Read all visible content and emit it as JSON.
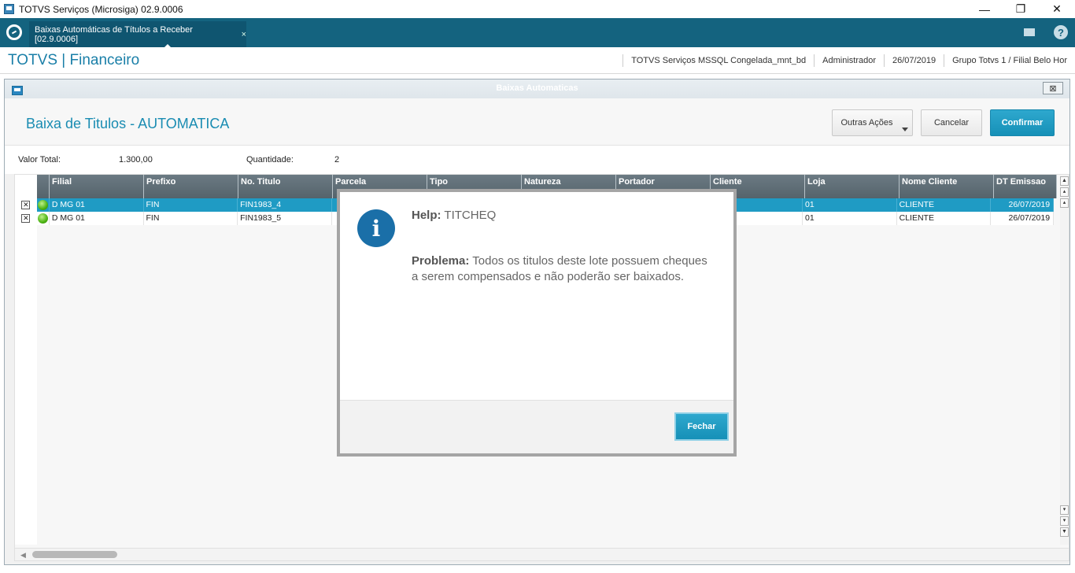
{
  "window": {
    "title": "TOTVS Serviços (Microsiga) 02.9.0006",
    "controls": [
      "—",
      "❐",
      "✕"
    ]
  },
  "tabbar": {
    "tab_label": "Baixas Automáticas de Títulos a Receber [02.9.0006]",
    "tab_close": "×",
    "help_glyph": "?"
  },
  "header": {
    "app_title": "TOTVS | Financeiro",
    "info": [
      "TOTVS Serviços MSSQL Congelada_mnt_bd",
      "Administrador",
      "26/07/2019",
      "Grupo Totvs 1 / Filial Belo Hor"
    ]
  },
  "dialog": {
    "title": "Baixas Automaticas",
    "close_glyph": "⊠",
    "form_title": "Baixa de Titulos - AUTOMATICA",
    "buttons": {
      "outras": "Outras Ações",
      "cancel": "Cancelar",
      "confirm": "Confirmar"
    },
    "totals": {
      "valor_label": "Valor Total:",
      "valor": "1.300,00",
      "qtd_label": "Quantidade:",
      "qtd": "2"
    }
  },
  "grid": {
    "columns": [
      "Filial",
      "Prefixo",
      "No. Titulo",
      "Parcela",
      "Tipo",
      "Natureza",
      "Portador",
      "Cliente",
      "Loja",
      "Nome Cliente",
      "DT Emissao"
    ],
    "rows": [
      {
        "filial": "D MG 01",
        "prefixo": "FIN",
        "titulo": "FIN1983_4",
        "loja": "01",
        "nome": "CLIENTE",
        "emissao": "26/07/2019",
        "selected": true
      },
      {
        "filial": "D MG 01",
        "prefixo": "FIN",
        "titulo": "FIN1983_5",
        "loja": "01",
        "nome": "CLIENTE",
        "emissao": "26/07/2019",
        "selected": false
      }
    ],
    "check_glyph": "✕"
  },
  "modal": {
    "help_label": "Help:",
    "help_code": "TITCHEQ",
    "problem_label": "Problema:",
    "problem_text": "Todos os titulos deste lote possuem cheques a serem compensados e não poderão ser baixados.",
    "icon_glyph": "i",
    "close_button": "Fechar"
  }
}
